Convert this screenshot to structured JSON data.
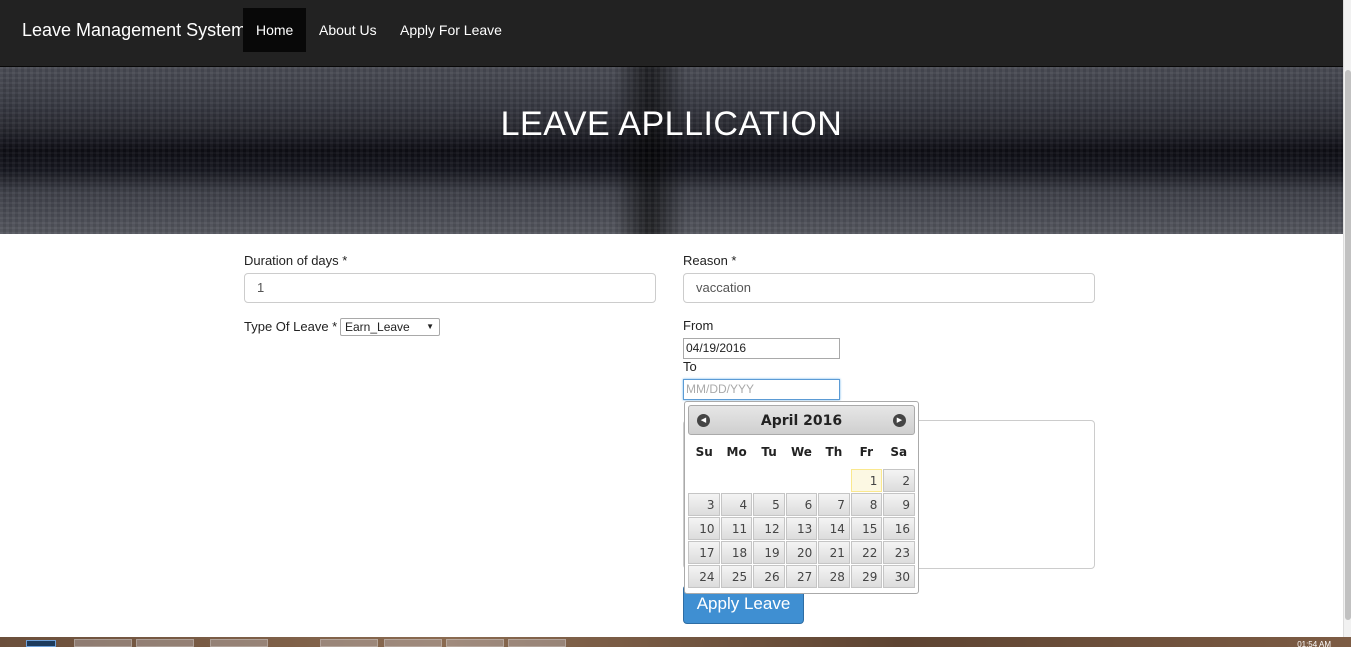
{
  "navbar": {
    "brand": "Leave Management System",
    "items": [
      {
        "label": "Home",
        "active": true
      },
      {
        "label": "About Us",
        "active": false
      },
      {
        "label": "Apply For Leave",
        "active": false
      }
    ]
  },
  "hero": {
    "title": "LEAVE APLLICATION"
  },
  "form": {
    "duration_label": "Duration of days *",
    "duration_value": "1",
    "reason_label": "Reason *",
    "reason_value": "vaccation",
    "type_label": "Type Of Leave *",
    "type_value": "Earn_Leave",
    "from_label": "From",
    "from_value": "04/19/2016",
    "to_label": "To",
    "to_placeholder": "MM/DD/YYY",
    "submit_label": "Apply Leave"
  },
  "datepicker": {
    "title": "April 2016",
    "weekdays": [
      "Su",
      "Mo",
      "Tu",
      "We",
      "Th",
      "Fr",
      "Sa"
    ],
    "weeks": [
      [
        "",
        "",
        "",
        "",
        "",
        "1",
        "2"
      ],
      [
        "3",
        "4",
        "5",
        "6",
        "7",
        "8",
        "9"
      ],
      [
        "10",
        "11",
        "12",
        "13",
        "14",
        "15",
        "16"
      ],
      [
        "17",
        "18",
        "19",
        "20",
        "21",
        "22",
        "23"
      ],
      [
        "24",
        "25",
        "26",
        "27",
        "28",
        "29",
        "30"
      ]
    ],
    "today": "1",
    "prev_icon": "prev-month-icon",
    "next_icon": "next-month-icon"
  },
  "taskbar": {
    "clock": "01:54 AM"
  },
  "colors": {
    "navbar": "#222222",
    "primary_button": "#3f8fd2"
  }
}
